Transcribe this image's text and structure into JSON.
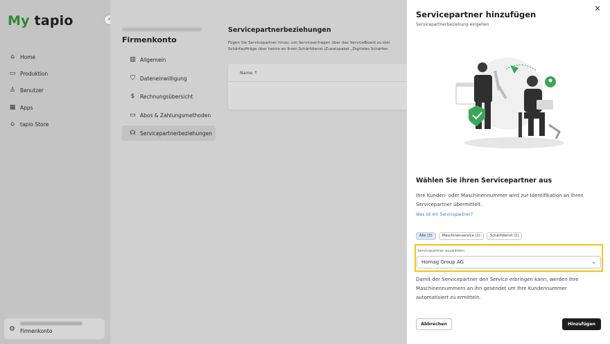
{
  "app": {
    "logo_my": "My",
    "logo_name": "tapio"
  },
  "nav": {
    "items": [
      {
        "label": "Home",
        "icon": "home-icon"
      },
      {
        "label": "Produktion",
        "icon": "folder-icon"
      },
      {
        "label": "Benutzer",
        "icon": "user-icon"
      },
      {
        "label": "Apps",
        "icon": "grid-icon"
      },
      {
        "label": "tapio Store",
        "icon": "store-icon"
      }
    ],
    "account_label": "Firmenkonto"
  },
  "account": {
    "title": "Firmenkonto",
    "menu": [
      {
        "label": "Allgemein",
        "icon": "building-icon"
      },
      {
        "label": "Dateneinwilligung",
        "icon": "shield-check-icon"
      },
      {
        "label": "Rechnungsübersicht",
        "icon": "dollar-icon"
      },
      {
        "label": "Abos & Zahlungsmethoden",
        "icon": "card-icon"
      },
      {
        "label": "Servicepartnerbeziehungen",
        "icon": "headset-icon"
      }
    ],
    "servicepartner": {
      "title": "Servicepartnerbeziehungen",
      "desc_line1": "Fügen Sie Servicepartner hinzu, um Serviceanfragen über das ServiceBoard zu stel",
      "desc_line2": "Schärfaufträge über twinio an Ihren Schärfdienst (Zusatzpaket „Digitales Schärfen",
      "column_name": "Name ↑"
    }
  },
  "panel": {
    "title": "Servicepartner hinzufügen",
    "subtitle": "Servicepartnerbeziehung eingehen",
    "choose_title": "Wählen Sie ihren Servicepartner aus",
    "choose_desc": "Ihre Kunden- oder Maschinennummer wird zur Identifikation an Ihren Servicepartner übermittelt.",
    "link": "Was ist ein Servicepartner?",
    "chips": [
      "Alle (3)",
      "Maschinenservice (2)",
      "Schärfdienst (1)"
    ],
    "field_label": "Servicepartner auswählen",
    "field_value": "Homag Group AG",
    "note": "Damit der Servicepartner den Service erbringen kann, werden Ihre Maschinennummern an ihn gesendet um Ihre Kundennummer automatisiert zu ermitteln.",
    "cancel": "Abbrechen",
    "add": "Hinzufügen"
  },
  "colors": {
    "brand_green": "#2f8a2f",
    "highlight": "#f2c511",
    "primary_button": "#1e1e1e",
    "link": "#2e7fd6"
  }
}
